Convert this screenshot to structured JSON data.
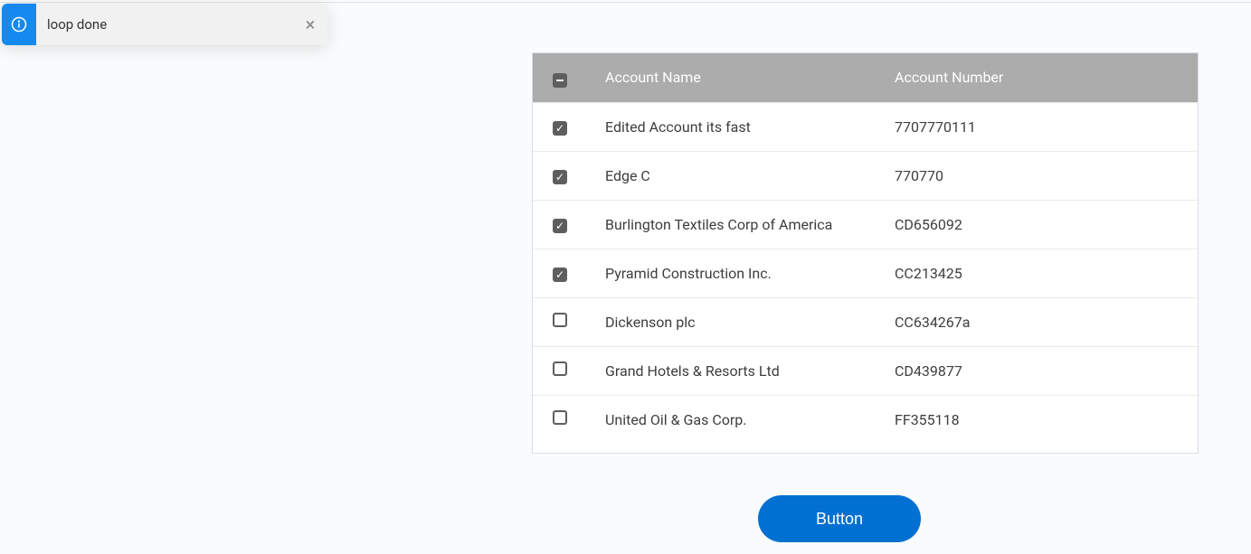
{
  "toast": {
    "message": "loop done"
  },
  "table": {
    "headers": {
      "name": "Account Name",
      "number": "Account Number"
    },
    "rows": [
      {
        "name": "Edited Account its fast",
        "number": "7707770111",
        "checked": true
      },
      {
        "name": "Edge C",
        "number": "770770",
        "checked": true
      },
      {
        "name": "Burlington Textiles Corp of America",
        "number": "CD656092",
        "checked": true
      },
      {
        "name": "Pyramid Construction Inc.",
        "number": "CC213425",
        "checked": true
      },
      {
        "name": "Dickenson plc",
        "number": "CC634267a",
        "checked": false
      },
      {
        "name": "Grand Hotels & Resorts Ltd",
        "number": "CD439877",
        "checked": false
      },
      {
        "name": "United Oil & Gas Corp.",
        "number": "FF355118",
        "checked": false
      }
    ]
  },
  "button": {
    "label": "Button"
  }
}
